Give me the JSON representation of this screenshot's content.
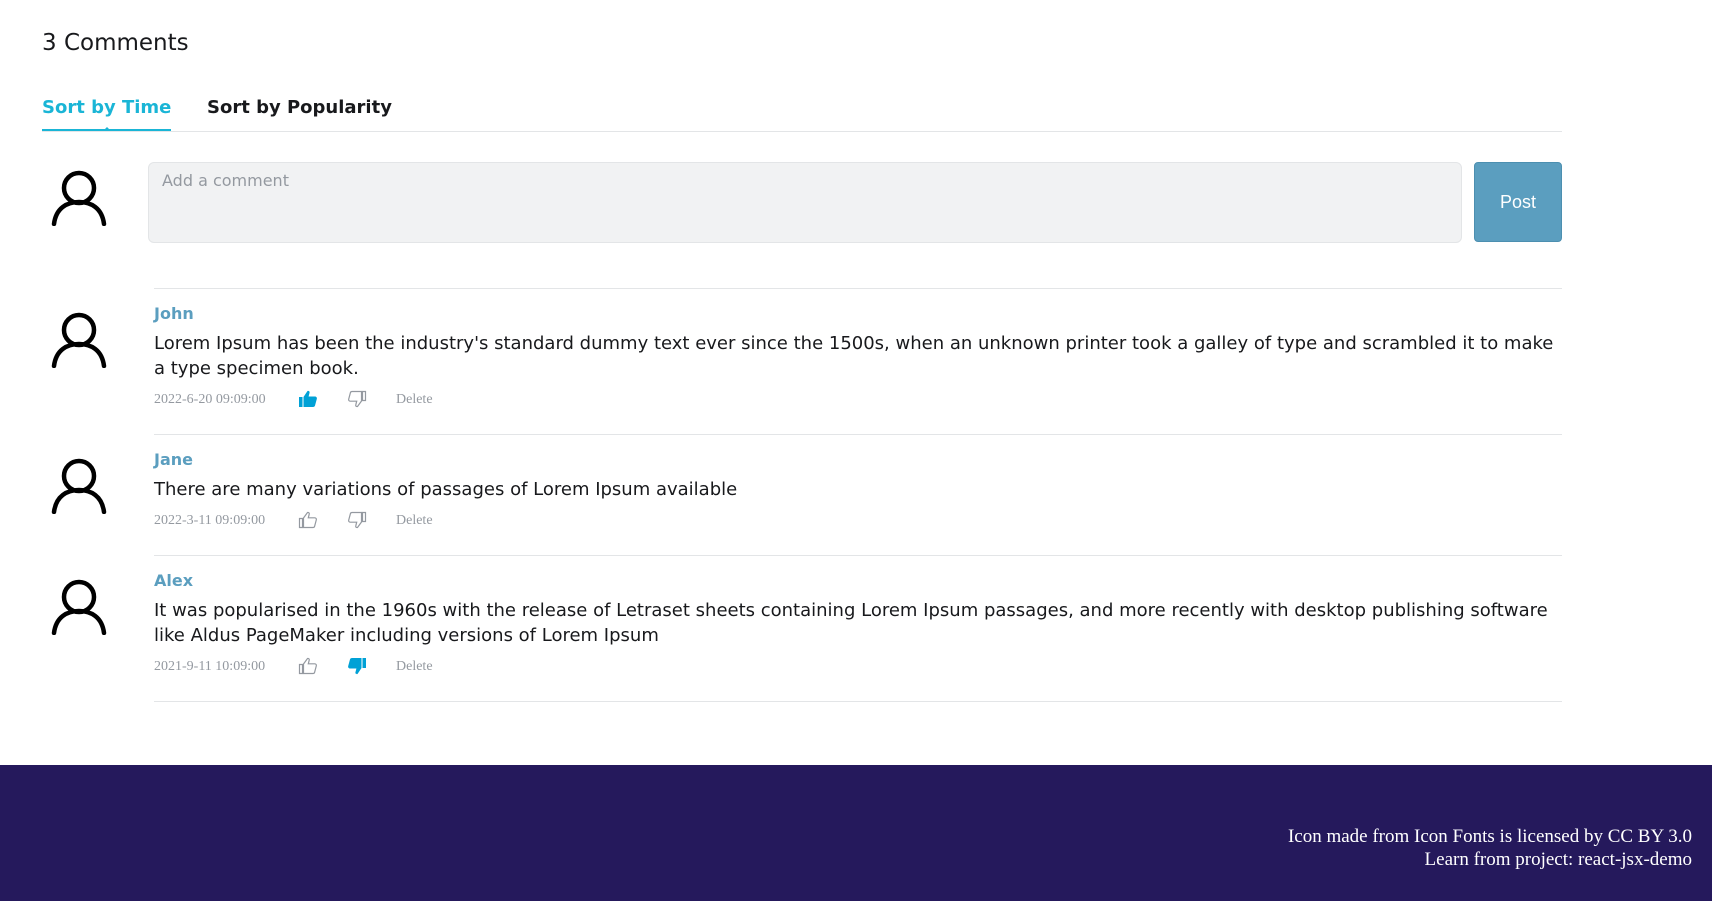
{
  "header": {
    "comment_count_title": "3 Comments"
  },
  "tabs": [
    {
      "label": "Sort by Time",
      "active": true
    },
    {
      "label": "Sort by Popularity",
      "active": false
    }
  ],
  "reply": {
    "placeholder": "Add a comment",
    "post_label": "Post"
  },
  "comments": [
    {
      "user": "John",
      "text": "Lorem Ipsum has been the industry's standard dummy text ever since the 1500s, when an unknown printer took a galley of type and scrambled it to make a type specimen book.",
      "time": "2022-6-20 09:09:00",
      "liked": true,
      "disliked": false,
      "delete_label": "Delete"
    },
    {
      "user": "Jane",
      "text": "There are many variations of passages of Lorem Ipsum available",
      "time": "2022-3-11 09:09:00",
      "liked": false,
      "disliked": false,
      "delete_label": "Delete"
    },
    {
      "user": "Alex",
      "text": "It was popularised in the 1960s with the release of Letraset sheets containing Lorem Ipsum passages, and more recently with desktop publishing software like Aldus PageMaker including versions of Lorem Ipsum",
      "time": "2021-9-11 10:09:00",
      "liked": false,
      "disliked": true,
      "delete_label": "Delete"
    }
  ],
  "footer": {
    "license_text": "Icon made from Icon Fonts is licensed by CC BY 3.0",
    "project_text": "Learn from project: react-jsx-demo"
  },
  "colors": {
    "accent": "#1ab5d6",
    "username": "#5b9ebf",
    "post_button": "#5b9ebf",
    "footer_bg": "#25195c",
    "thumb_active": "#00a1d6",
    "thumb_inactive": "#9499a0"
  },
  "icons": {
    "avatar": "user-outline-icon",
    "like": "thumbs-up-icon",
    "dislike": "thumbs-down-icon"
  }
}
